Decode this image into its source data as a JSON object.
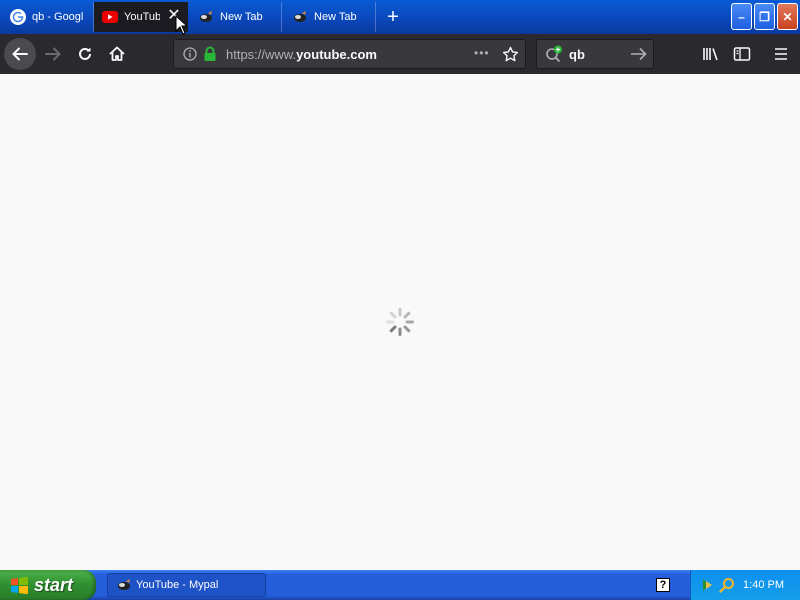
{
  "tabs": [
    {
      "label": "qb - Googl",
      "icon": "google-icon"
    },
    {
      "label": "YouTub",
      "icon": "youtube-icon",
      "active": true
    },
    {
      "label": "New Tab",
      "icon": "mypal-icon"
    },
    {
      "label": "New Tab",
      "icon": "mypal-icon"
    }
  ],
  "new_tab_symbol": "+",
  "tab_close_symbol": "✕",
  "window_controls": {
    "minimize": "–",
    "restore": "❐",
    "close": "✕"
  },
  "urlbar": {
    "prefix": "https://www.",
    "domain": "youtube.com",
    "suffix": ".com",
    "host": "youtube"
  },
  "url_dots": "•••",
  "search": {
    "value": "qb"
  },
  "taskbar": {
    "start_label": "start",
    "task_label": "YouTube - Mypal",
    "clock": "1:40 PM",
    "help": "?"
  },
  "colors": {
    "tabstrip": "#0b46b8",
    "toolbar": "#2a2a2e",
    "lock": "#2bb83a",
    "taskbar": "#245edb",
    "start": "#2f8f2f"
  }
}
